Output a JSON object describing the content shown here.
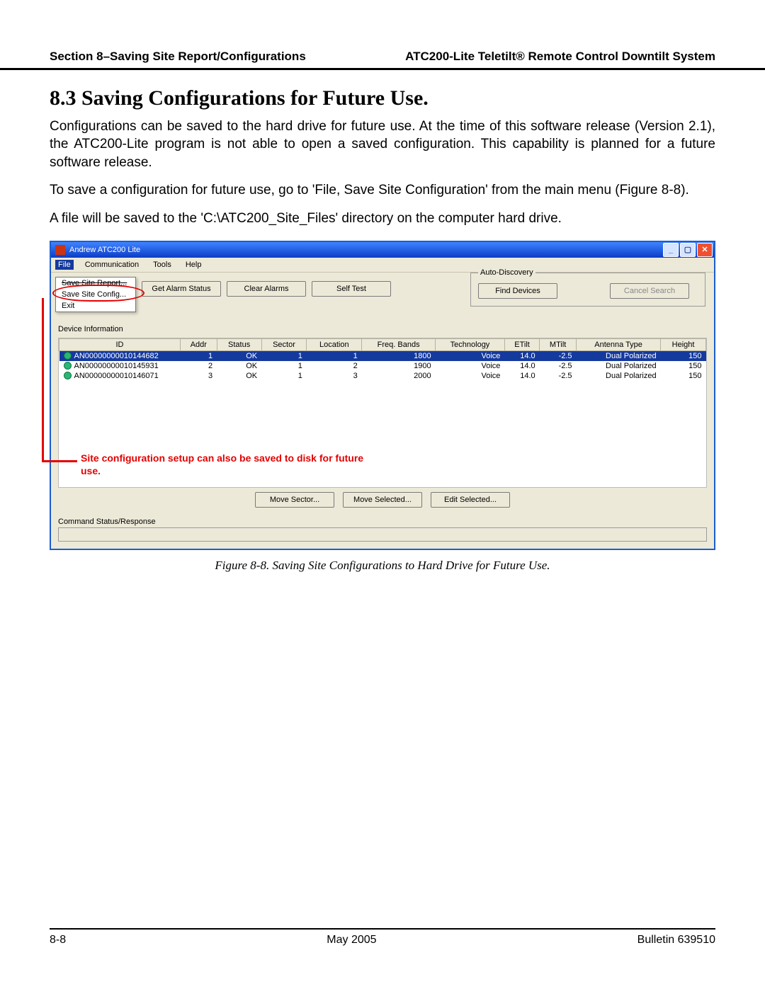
{
  "header": {
    "left": "Section 8–Saving Site Report/Configurations",
    "right": "ATC200-Lite Teletilt® Remote Control Downtilt System"
  },
  "section": {
    "heading": "8.3 Saving Configurations for Future Use.",
    "p1": "Configurations can be saved to the hard drive for future use. At the time of this software release (Version 2.1), the ATC200-Lite program is not able to open a saved configuration. This capability is planned for a future software release.",
    "p2": "To save a configuration for future use, go to 'File, Save Site Configuration' from the main menu (Figure 8-8).",
    "p3": "A file will be saved to the 'C:\\ATC200_Site_Files' directory on the computer hard drive."
  },
  "window": {
    "title": "Andrew ATC200 Lite",
    "menu": {
      "file": "File",
      "comm": "Communication",
      "tools": "Tools",
      "help": "Help"
    },
    "filemenu": {
      "saveReport": "Save Site Report...",
      "saveConfig": "Save Site Config...",
      "exit": "Exit"
    },
    "buttons": {
      "getAlarmStatus": "Get Alarm Status",
      "clearAlarms": "Clear Alarms",
      "selfTest": "Self Test",
      "findDevices": "Find Devices",
      "cancelSearch": "Cancel Search",
      "moveSector": "Move Sector...",
      "moveSelected": "Move Selected...",
      "editSelected": "Edit Selected..."
    },
    "groups": {
      "autoDiscovery": "Auto-Discovery",
      "deviceInfo": "Device Information",
      "cmdStatus": "Command Status/Response"
    },
    "cols": {
      "id": "ID",
      "addr": "Addr",
      "status": "Status",
      "sector": "Sector",
      "location": "Location",
      "freq": "Freq. Bands",
      "tech": "Technology",
      "etilt": "ETilt",
      "mtilt": "MTilt",
      "antenna": "Antenna Type",
      "height": "Height"
    },
    "rows": [
      {
        "id": "AN00000000010144682",
        "addr": "1",
        "status": "OK",
        "sector": "1",
        "location": "1",
        "freq": "1800",
        "tech": "Voice",
        "etilt": "14.0",
        "mtilt": "-2.5",
        "antenna": "Dual Polarized",
        "height": "150",
        "selected": true
      },
      {
        "id": "AN00000000010145931",
        "addr": "2",
        "status": "OK",
        "sector": "1",
        "location": "2",
        "freq": "1900",
        "tech": "Voice",
        "etilt": "14.0",
        "mtilt": "-2.5",
        "antenna": "Dual Polarized",
        "height": "150"
      },
      {
        "id": "AN00000000010146071",
        "addr": "3",
        "status": "OK",
        "sector": "1",
        "location": "3",
        "freq": "2000",
        "tech": "Voice",
        "etilt": "14.0",
        "mtilt": "-2.5",
        "antenna": "Dual Polarized",
        "height": "150"
      }
    ],
    "annotation": "Site configuration setup can also be saved to disk for future use."
  },
  "caption": "Figure 8-8. Saving Site Configurations to Hard Drive for Future Use.",
  "footer": {
    "left": "8-8",
    "center": "May 2005",
    "right": "Bulletin 639510"
  }
}
